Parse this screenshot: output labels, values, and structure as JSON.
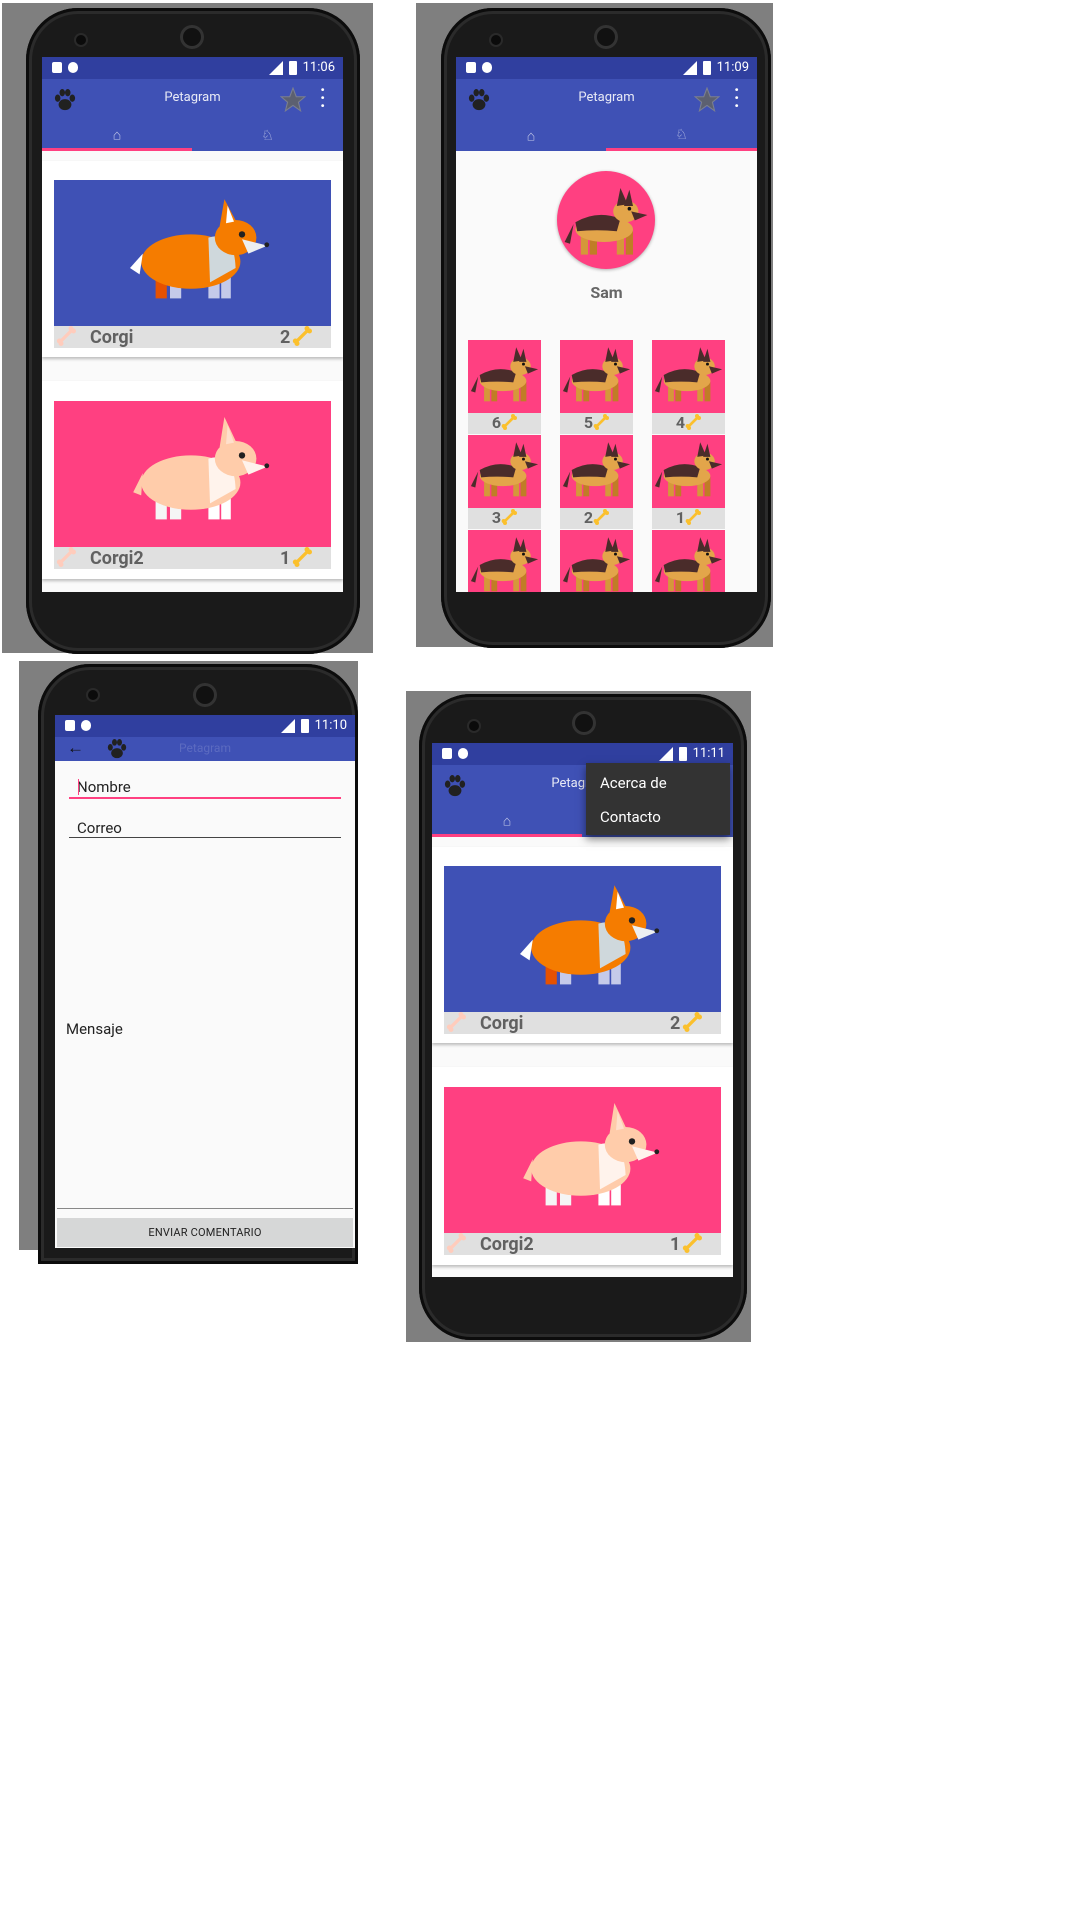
{
  "phones": [
    {
      "time": "11:06",
      "app_title": "Petagram",
      "cards": [
        {
          "name": "Corgi",
          "likes": "2"
        },
        {
          "name": "Corgi2",
          "likes": "1"
        }
      ]
    },
    {
      "time": "11:09",
      "app_title": "Petagram",
      "profile_name": "Sam",
      "thumbs": [
        {
          "likes": "6"
        },
        {
          "likes": "5"
        },
        {
          "likes": "4"
        },
        {
          "likes": "3"
        },
        {
          "likes": "2"
        },
        {
          "likes": "1"
        }
      ]
    },
    {
      "time": "11:10",
      "app_title": "Petagram",
      "form": {
        "name_placeholder": "Nombre",
        "email_placeholder": "Correo",
        "message_placeholder": "Mensaje",
        "submit_label": "ENVIAR COMENTARIO"
      }
    },
    {
      "time": "11:11",
      "app_title": "Petagram",
      "menu": [
        "Acerca de",
        "Contacto"
      ],
      "cards": [
        {
          "name": "Corgi",
          "likes": "2"
        },
        {
          "name": "Corgi2",
          "likes": "1"
        }
      ]
    }
  ],
  "colors": {
    "primary": "#3f51b5",
    "primary_dark": "#303f9f",
    "accent": "#ff4081",
    "card_footer": "#e0e0e0"
  },
  "icons": [
    "paw-icon",
    "star-icon",
    "more-vert-icon",
    "home-icon",
    "dog-tab-icon",
    "bone-icon",
    "golden-bone-icon",
    "back-arrow-icon"
  ]
}
